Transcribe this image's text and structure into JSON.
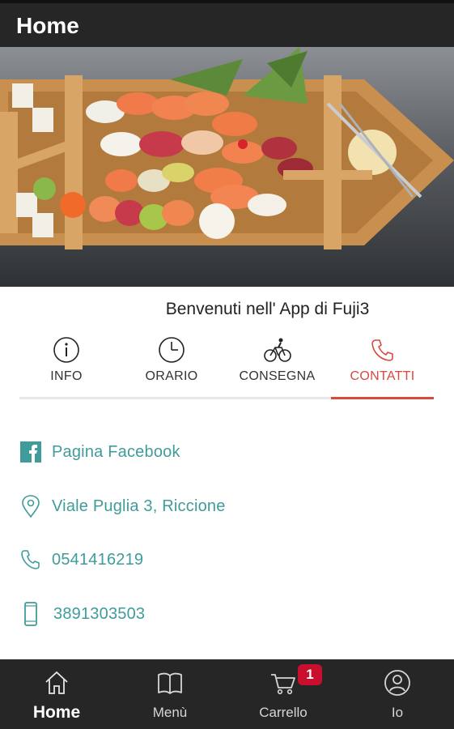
{
  "header": {
    "title": "Home"
  },
  "hero": {
    "slides_total": 1,
    "active_slide": 1
  },
  "welcome": {
    "text": "Benvenuti nell' App di Fuji3"
  },
  "tabs": [
    {
      "label": "INFO",
      "icon": "info-icon"
    },
    {
      "label": "ORARIO",
      "icon": "clock-icon"
    },
    {
      "label": "CONSEGNA",
      "icon": "bicycle-icon"
    },
    {
      "label": "CONTATTI",
      "icon": "phone-icon",
      "active": true
    }
  ],
  "contacts": [
    {
      "label": "Pagina Facebook",
      "icon": "facebook-icon"
    },
    {
      "label": "Viale Puglia 3, Riccione",
      "icon": "location-pin-icon"
    },
    {
      "label": "0541416219",
      "icon": "phone-icon"
    },
    {
      "label": "3891303503",
      "icon": "mobile-phone-icon"
    }
  ],
  "bottom_nav": [
    {
      "label": "Home",
      "icon": "home-icon",
      "active": true
    },
    {
      "label": "Menù",
      "icon": "book-icon"
    },
    {
      "label": "Carrello",
      "icon": "cart-icon",
      "badge": "1"
    },
    {
      "label": "Io",
      "icon": "user-icon"
    }
  ],
  "colors": {
    "bar": "#262626",
    "accent": "#d9493e",
    "link": "#3f9c9a",
    "badge": "#c8102e",
    "dot": "#1e88e5"
  }
}
